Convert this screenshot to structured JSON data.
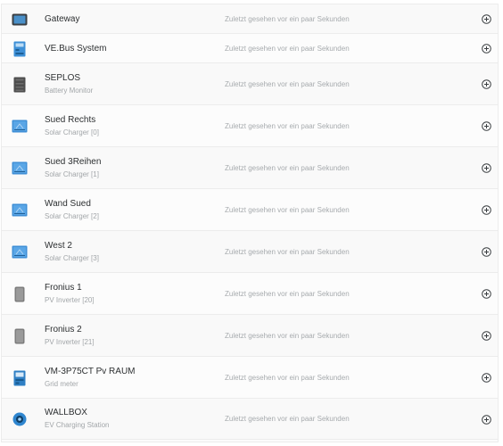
{
  "devices": [
    {
      "name": "Gateway",
      "type": "",
      "icon": "gateway-icon",
      "seen": "Zuletzt gesehen vor ein paar Sekunden"
    },
    {
      "name": "VE.Bus System",
      "type": "",
      "icon": "inverter-charger-icon",
      "seen": "Zuletzt gesehen vor ein paar Sekunden"
    },
    {
      "name": "SEPLOS",
      "type": "Battery Monitor",
      "icon": "battery-monitor-icon",
      "seen": "Zuletzt gesehen vor ein paar Sekunden"
    },
    {
      "name": "Sued Rechts",
      "type": "Solar Charger [0]",
      "icon": "solar-charger-icon",
      "seen": "Zuletzt gesehen vor ein paar Sekunden"
    },
    {
      "name": "Sued 3Reihen",
      "type": "Solar Charger [1]",
      "icon": "solar-charger-icon",
      "seen": "Zuletzt gesehen vor ein paar Sekunden"
    },
    {
      "name": "Wand Sued",
      "type": "Solar Charger [2]",
      "icon": "solar-charger-icon",
      "seen": "Zuletzt gesehen vor ein paar Sekunden"
    },
    {
      "name": "West 2",
      "type": "Solar Charger [3]",
      "icon": "solar-charger-icon",
      "seen": "Zuletzt gesehen vor ein paar Sekunden"
    },
    {
      "name": "Fronius 1",
      "type": "PV Inverter [20]",
      "icon": "pv-inverter-icon",
      "seen": "Zuletzt gesehen vor ein paar Sekunden"
    },
    {
      "name": "Fronius 2",
      "type": "PV Inverter [21]",
      "icon": "pv-inverter-icon",
      "seen": "Zuletzt gesehen vor ein paar Sekunden"
    },
    {
      "name": "VM-3P75CT Pv RAUM",
      "type": "Grid meter",
      "icon": "grid-meter-icon",
      "seen": "Zuletzt gesehen vor ein paar Sekunden"
    },
    {
      "name": "WALLBOX",
      "type": "EV Charging Station",
      "icon": "ev-charger-icon",
      "seen": "Zuletzt gesehen vor ein paar Sekunden"
    }
  ]
}
